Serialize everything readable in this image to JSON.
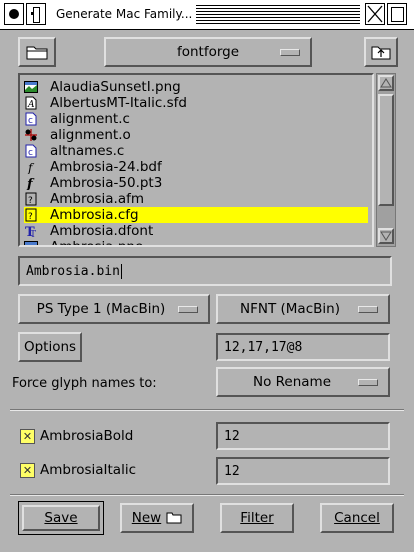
{
  "window": {
    "title": "Generate Mac Family..."
  },
  "path_menu": {
    "label": "fontforge"
  },
  "files": [
    {
      "name": "AlaudiaSunsetI.png",
      "icon": "image-file-icon",
      "selected": false
    },
    {
      "name": "AlbertusMT-Italic.sfd",
      "icon": "sfd-file-icon",
      "selected": false
    },
    {
      "name": "alignment.c",
      "icon": "c-source-file-icon",
      "selected": false
    },
    {
      "name": "alignment.o",
      "icon": "object-file-icon",
      "selected": false
    },
    {
      "name": "altnames.c",
      "icon": "c-source-file-icon",
      "selected": false
    },
    {
      "name": "Ambrosia-24.bdf",
      "icon": "bitmap-font-file-icon",
      "selected": false
    },
    {
      "name": "Ambrosia-50.pt3",
      "icon": "type3-font-file-icon",
      "selected": false
    },
    {
      "name": "Ambrosia.afm",
      "icon": "unknown-file-icon",
      "selected": false
    },
    {
      "name": "Ambrosia.cfg",
      "icon": "unknown-file-icon",
      "selected": true
    },
    {
      "name": "Ambrosia.dfont",
      "icon": "truetype-font-file-icon",
      "selected": false
    },
    {
      "name": "Ambrosia.pne",
      "icon": "image-file-icon",
      "selected": false
    }
  ],
  "filename_input": {
    "value": "Ambrosia.bin"
  },
  "outline_format": {
    "label": "PS Type 1 (MacBin)"
  },
  "bitmap_format": {
    "label": "NFNT (MacBin)"
  },
  "options_button": {
    "label": "Options"
  },
  "bitmap_sizes": {
    "value": "12,17,17@8"
  },
  "force_glyph": {
    "label": "Force glyph names to:",
    "value": "No Rename"
  },
  "family": [
    {
      "name": "AmbrosiaBold",
      "checked": true,
      "size": "12"
    },
    {
      "name": "AmbrosiaItalic",
      "checked": true,
      "size": "12"
    }
  ],
  "buttons": {
    "save": "Save",
    "new": "New",
    "filter": "Filter",
    "cancel": "Cancel"
  }
}
